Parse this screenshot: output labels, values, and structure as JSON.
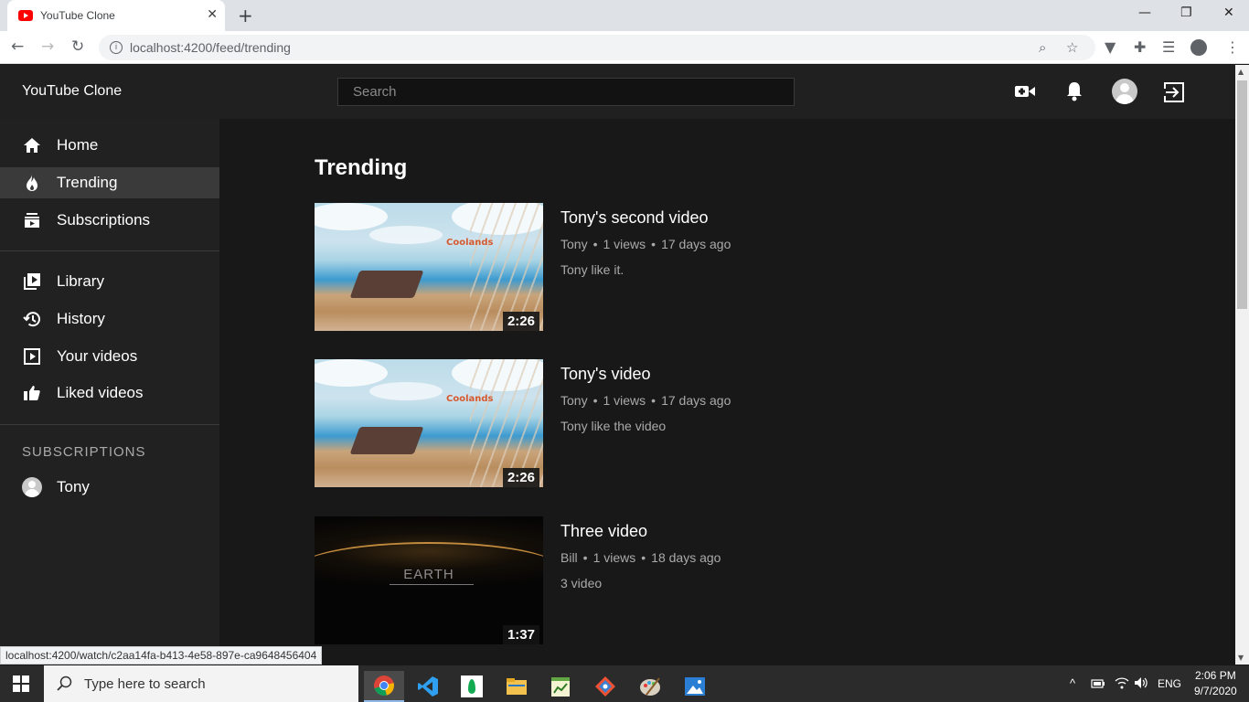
{
  "browser": {
    "tab_title": "YouTube Clone",
    "tab_close": "✕",
    "new_tab": "+",
    "url": "localhost:4200/feed/trending",
    "status_url": "localhost:4200/watch/c2aa14fa-b413-4e58-897e-ca9648456404"
  },
  "header": {
    "brand": "YouTube Clone",
    "search_placeholder": "Search"
  },
  "sidebar": {
    "items": [
      {
        "label": "Home",
        "icon": "home-icon"
      },
      {
        "label": "Trending",
        "icon": "fire-icon"
      },
      {
        "label": "Subscriptions",
        "icon": "subscriptions-icon"
      },
      {
        "label": "Library",
        "icon": "library-icon"
      },
      {
        "label": "History",
        "icon": "history-icon"
      },
      {
        "label": "Your videos",
        "icon": "your-videos-icon"
      },
      {
        "label": "Liked videos",
        "icon": "thumbs-up-icon"
      }
    ],
    "subscriptions_heading": "SUBSCRIPTIONS",
    "subscriptions": [
      {
        "name": "Tony"
      }
    ]
  },
  "main": {
    "title": "Trending",
    "videos": [
      {
        "title": "Tony's second video",
        "channel": "Tony",
        "views": "1 views",
        "age": "17 days ago",
        "description": "Tony like it.",
        "duration": "2:26",
        "thumb_logo": "Coolands"
      },
      {
        "title": "Tony's video",
        "channel": "Tony",
        "views": "1 views",
        "age": "17 days ago",
        "description": "Tony like the video",
        "duration": "2:26",
        "thumb_logo": "Coolands"
      },
      {
        "title": "Three video",
        "channel": "Bill",
        "views": "1 views",
        "age": "18 days ago",
        "description": "3 video",
        "duration": "1:37",
        "thumb_text": "EARTH"
      }
    ]
  },
  "taskbar": {
    "search_placeholder": "Type here to search",
    "language": "ENG",
    "time": "2:06 PM",
    "date": "9/7/2020"
  },
  "colors": {
    "app_bg": "#181818",
    "header_bg": "#202020",
    "sidebar_bg": "#212121",
    "active_item": "#3a3a3a",
    "brand_red": "#ff0000"
  }
}
